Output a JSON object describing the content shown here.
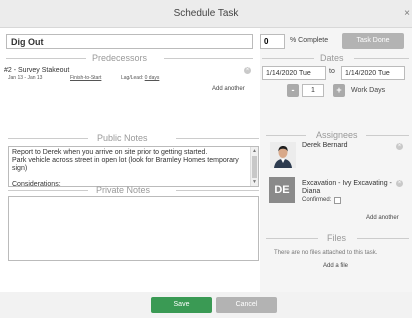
{
  "dialog": {
    "title": "Schedule Task",
    "close_glyph": "×"
  },
  "task": {
    "name": "Dig Out",
    "percent_complete": "0",
    "percent_label": "% Complete",
    "done_button": "Task Done"
  },
  "predecessors": {
    "header": "Predecessors",
    "items": [
      {
        "name": "#2 - Survey Stakeout",
        "dates": "Jan 13 - Jan 13",
        "type": "Finish-to-Start",
        "lag_label": "Lag/Lead:",
        "lag_value": "0 days"
      }
    ],
    "add_another": "Add another"
  },
  "dates": {
    "header": "Dates",
    "start": "1/14/2020 Tue",
    "to_label": "to",
    "end": "1/14/2020 Tue",
    "work_days": "1",
    "work_days_label": "Work Days",
    "minus": "-",
    "plus": "+"
  },
  "public_notes": {
    "header": "Public Notes",
    "text": "Report to Derek when you arrive on site prior to getting started.\nPark vehicle across street in open lot (look for Bramley Homes temporary sign)\n\nConsiderations:\n*All current and abandoned utility lines marked and compared against drawings prior to dig."
  },
  "private_notes": {
    "header": "Private Notes"
  },
  "assignees": {
    "header": "Assignees",
    "items": [
      {
        "name": "Derek Bernard"
      },
      {
        "initials": "DE",
        "name": "Excavation - Ivy Excavating - Diana",
        "confirmed_label": "Confirmed:"
      }
    ],
    "add_another": "Add another"
  },
  "files": {
    "header": "Files",
    "empty_text": "There are no files attached to this task.",
    "add_file": "Add a file"
  },
  "footer": {
    "save": "Save",
    "cancel": "Cancel"
  },
  "colors": {
    "save_green": "#3a9a54",
    "button_gray": "#b3b3b3"
  },
  "icons": {
    "close": "close-icon",
    "remove": "remove-circle-icon",
    "minus": "minus-icon",
    "plus": "plus-icon"
  }
}
